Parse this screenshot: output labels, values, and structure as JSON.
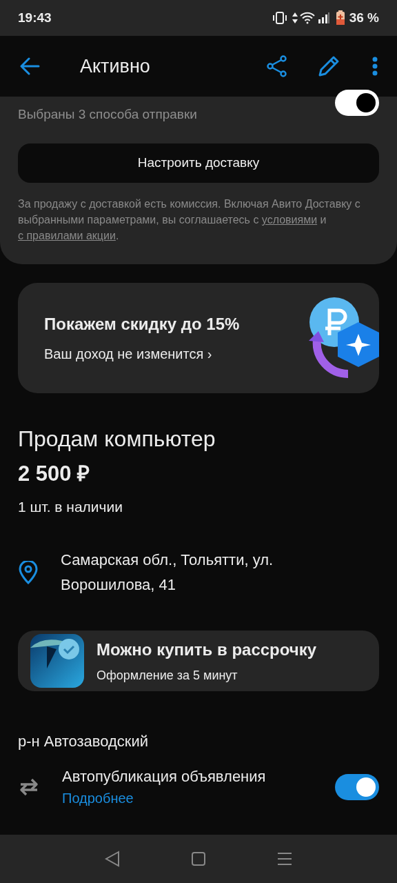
{
  "status_bar": {
    "time": "19:43",
    "battery": "36 %"
  },
  "header": {
    "title": "Активно"
  },
  "delivery": {
    "subtitle": "Выбраны 3 способа отправки",
    "toggle_on": true,
    "button": "Настроить доставку",
    "disclaimer": "За продажу с доставкой есть комиссия. Включая Авито Доставку с выбранными параметрами, вы соглашаетесь",
    "disclaimer_pre": "с",
    "link_terms": "условиями",
    "disclaimer_and": "и",
    "link_rules": "с правилами акции",
    "disclaimer_end": "."
  },
  "promo": {
    "title": "Покажем скидку до 15%",
    "subtitle": "Ваш доход не изменится",
    "chevron": "›"
  },
  "listing": {
    "title": "Продам компьютер",
    "price": "2 500 ₽",
    "stock": "1 шт. в наличии",
    "address": "Самарская обл., Тольятти, ул. Ворошилова, 41"
  },
  "installment": {
    "title": "Можно купить в рассрочку",
    "subtitle": "Оформление за 5 минут"
  },
  "district": "р-н Автозаводский",
  "autopublish": {
    "title": "Автопубликация объявления",
    "link": "Подробнее",
    "on": true
  }
}
